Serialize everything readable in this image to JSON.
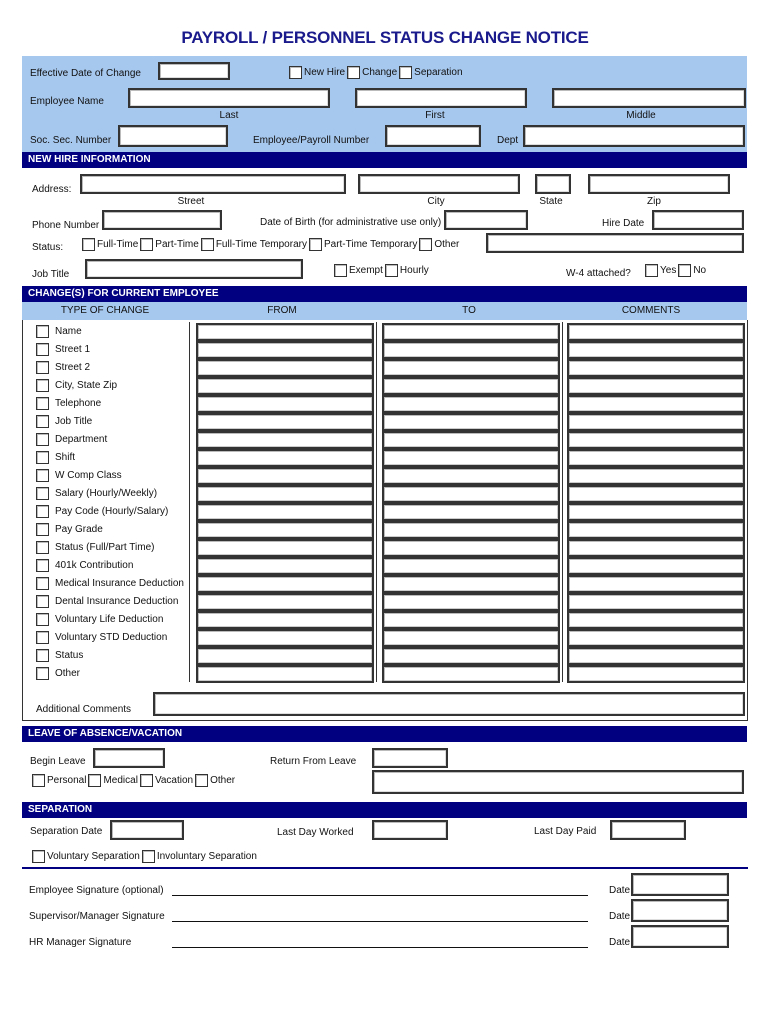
{
  "title": "PAYROLL / PERSONNEL STATUS  CHANGE  NOTICE",
  "colors": {
    "header_bar": "#000080",
    "panel": "#a7c8ee",
    "title": "#1a1a8c"
  },
  "top": {
    "effective_date_label": "Effective Date of Change",
    "change_types": [
      "New Hire",
      "Change",
      "Separation"
    ],
    "employee_name_label": "Employee Name",
    "name_parts": [
      "Last",
      "First",
      "Middle"
    ],
    "ssn_label": "Soc. Sec. Number",
    "payroll_number_label": "Employee/Payroll Number",
    "dept_label": "Dept"
  },
  "new_hire": {
    "header": "NEW HIRE INFORMATION",
    "address_label": "Address:",
    "address_parts": [
      "Street",
      "City",
      "State",
      "Zip"
    ],
    "phone_label": "Phone Number",
    "dob_label": "Date of Birth (for administrative use only)",
    "hire_date_label": "Hire Date",
    "status_label": "Status:",
    "status_options": [
      "Full-Time",
      "Part-Time",
      "Full-Time Temporary",
      "Part-Time Temporary",
      "Other"
    ],
    "job_title_label": "Job Title",
    "pay_type_options": [
      "Exempt",
      "Hourly"
    ],
    "w4_label": "W-4 attached?",
    "w4_options": [
      "Yes",
      "No"
    ]
  },
  "changes": {
    "header": "CHANGE(S) FOR CURRENT EMPLOYEE",
    "columns": [
      "TYPE OF CHANGE",
      "FROM",
      "TO",
      "COMMENTS"
    ],
    "items": [
      "Name",
      "Street 1",
      "Street 2",
      "City, State Zip",
      "Telephone",
      "Job Title",
      "Department",
      "Shift",
      "W Comp Class",
      "Salary (Hourly/Weekly)",
      "Pay Code (Hourly/Salary)",
      "Pay Grade",
      "Status (Full/Part Time)",
      "401k Contribution",
      "Medical Insurance Deduction",
      "Dental Insurance Deduction",
      "Voluntary Life Deduction",
      "Voluntary STD Deduction",
      "Status",
      "Other"
    ],
    "additional_comments_label": "Additional Comments"
  },
  "leave": {
    "header": "LEAVE OF ABSENCE/VACATION",
    "begin_label": "Begin Leave",
    "return_label": "Return From Leave",
    "types": [
      "Personal",
      "Medical",
      "Vacation",
      "Other"
    ]
  },
  "separation": {
    "header": "SEPARATION",
    "date_label": "Separation Date",
    "last_worked_label": "Last Day Worked",
    "last_paid_label": "Last Day Paid",
    "types": [
      "Voluntary Separation",
      "Involuntary Separation"
    ]
  },
  "signatures": [
    {
      "label": "Employee Signature (optional)",
      "date_label": "Date"
    },
    {
      "label": "Supervisor/Manager Signature",
      "date_label": "Date"
    },
    {
      "label": "HR Manager Signature",
      "date_label": "Date"
    }
  ]
}
